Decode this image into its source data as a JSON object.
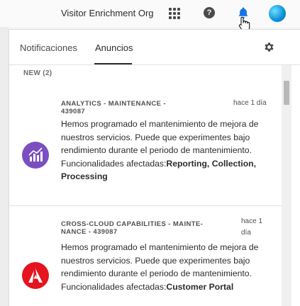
{
  "topbar": {
    "org_name": "Visitor Enrichment Org",
    "help_glyph": "?",
    "icons": [
      "apps-grid-icon",
      "help-icon",
      "bell-icon",
      "hand-cursor-icon"
    ]
  },
  "panel": {
    "tabs": [
      {
        "label": "Notificaciones",
        "selected": false
      },
      {
        "label": "Anuncios",
        "selected": true
      }
    ],
    "section_label": "NEW (2)",
    "announcements": [
      {
        "title": "ANALYTICS - MAINTENANCE - 439087",
        "date": "hace 1 día",
        "body": "Hemos programado el mantenimiento de mejora de nuestros servicios. Puede que experimentes bajo rendimiento durante el periodo de mantenimiento.",
        "affected_prefix": "Funcionalidades afectadas:",
        "affected": "Reporting, Collection, Processing",
        "icon": "analytics-chart-icon",
        "icon_color": "#7b4fc2"
      },
      {
        "title": "CROSS-CLOUD CAPABILITIES - MAINTE-NANCE - 439087",
        "date": "hace 1 día",
        "body": "Hemos programado el mantenimiento de mejora de nuestros servicios. Puede que experimentes bajo rendimiento durante el periodo de mantenimiento.",
        "affected_prefix": "Funcionalidades afectadas:",
        "affected": "Customer Portal",
        "icon": "adobe-logo-icon",
        "icon_color": "#e5141d"
      }
    ]
  },
  "colors": {
    "accent": "#0265dc",
    "avatar": "#0a8fd6"
  }
}
